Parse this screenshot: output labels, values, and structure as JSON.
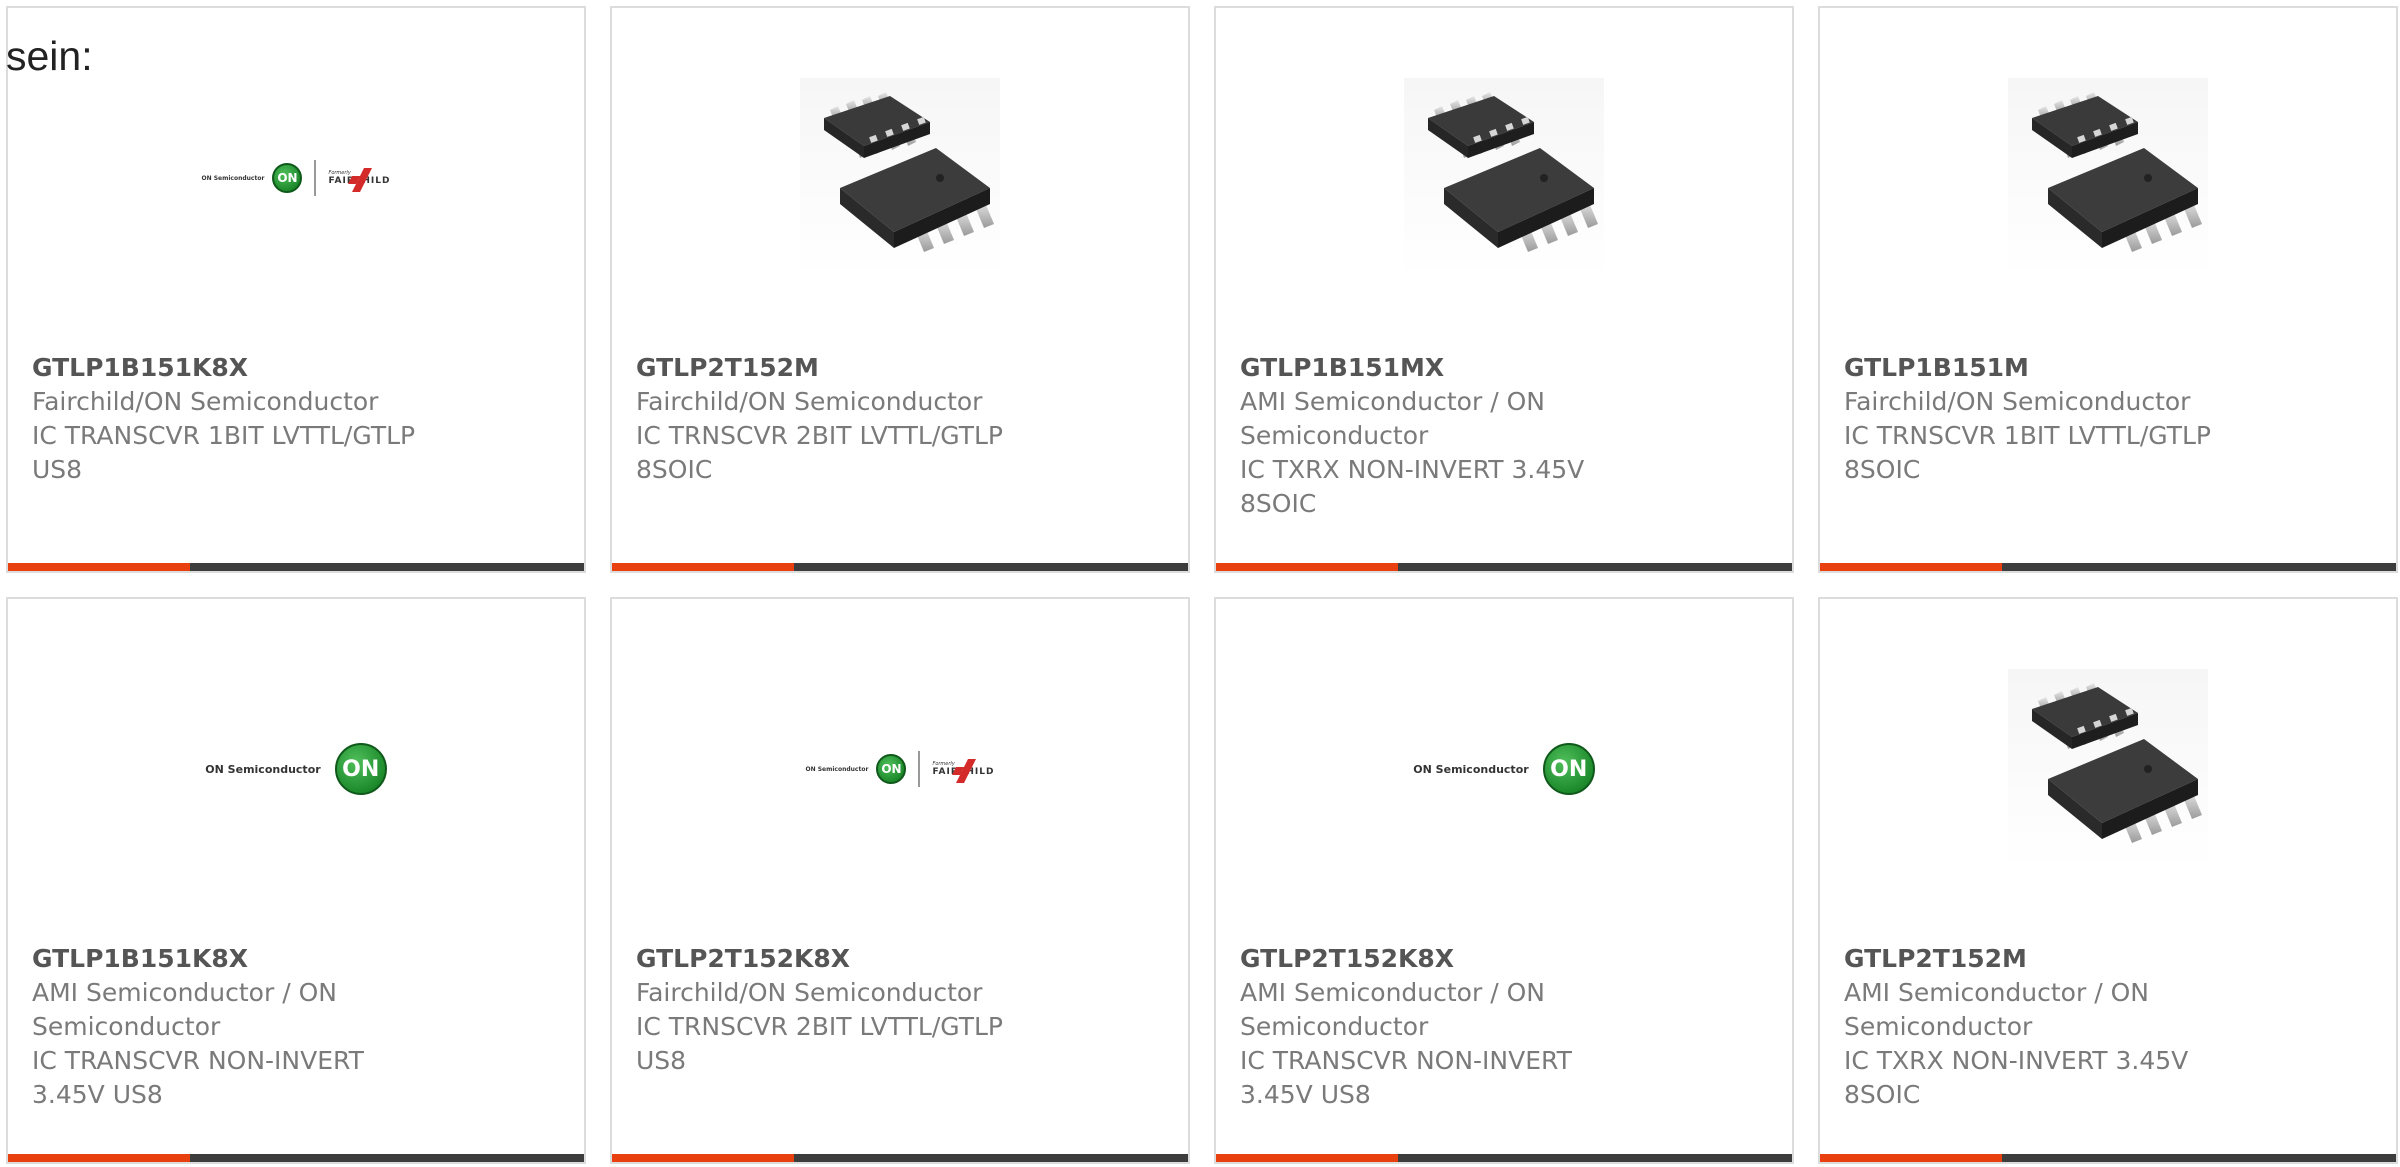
{
  "intro_text": "sein:",
  "colors": {
    "accent_bar": "#e8400f",
    "bar_dark": "#3d3d3d",
    "card_border": "#dcdcdc",
    "part_number": "#555555",
    "body_text": "#7a7a7a"
  },
  "logos": {
    "on_semiconductor": "ON Semiconductor",
    "on_badge": "ON",
    "formerly": "Formerly",
    "fairchild": "FAIRCHILD"
  },
  "products": [
    {
      "part_number": "GTLP1B151K8X",
      "image": "on-fairchild-logo",
      "manufacturer_lines": [
        "Fairchild/ON Semiconductor"
      ],
      "description_lines": [
        "IC TRANSCVR 1BIT LVTTL/GTLP",
        "US8"
      ]
    },
    {
      "part_number": "GTLP2T152M",
      "image": "soic8-chip-photo",
      "manufacturer_lines": [
        "Fairchild/ON Semiconductor"
      ],
      "description_lines": [
        "IC TRNSCVR 2BIT LVTTL/GTLP",
        "8SOIC"
      ]
    },
    {
      "part_number": "GTLP1B151MX",
      "image": "soic8-chip-photo",
      "manufacturer_lines": [
        "AMI Semiconductor / ON",
        "Semiconductor"
      ],
      "description_lines": [
        "IC TXRX NON-INVERT 3.45V",
        "8SOIC"
      ]
    },
    {
      "part_number": "GTLP1B151M",
      "image": "soic8-chip-photo",
      "manufacturer_lines": [
        "Fairchild/ON Semiconductor"
      ],
      "description_lines": [
        "IC TRNSCVR 1BIT LVTTL/GTLP",
        "8SOIC"
      ]
    },
    {
      "part_number": "GTLP1B151K8X",
      "image": "on-semiconductor-logo",
      "manufacturer_lines": [
        "AMI Semiconductor / ON",
        "Semiconductor"
      ],
      "description_lines": [
        "IC TRANSCVR NON-INVERT",
        "3.45V US8"
      ]
    },
    {
      "part_number": "GTLP2T152K8X",
      "image": "on-fairchild-logo",
      "manufacturer_lines": [
        "Fairchild/ON Semiconductor"
      ],
      "description_lines": [
        "IC TRNSCVR 2BIT LVTTL/GTLP",
        "US8"
      ]
    },
    {
      "part_number": "GTLP2T152K8X",
      "image": "on-semiconductor-logo",
      "manufacturer_lines": [
        "AMI Semiconductor / ON",
        "Semiconductor"
      ],
      "description_lines": [
        "IC TRANSCVR NON-INVERT",
        "3.45V US8"
      ]
    },
    {
      "part_number": "GTLP2T152M",
      "image": "soic8-chip-photo",
      "manufacturer_lines": [
        "AMI Semiconductor / ON",
        "Semiconductor"
      ],
      "description_lines": [
        "IC TXRX NON-INVERT 3.45V",
        "8SOIC"
      ]
    }
  ]
}
